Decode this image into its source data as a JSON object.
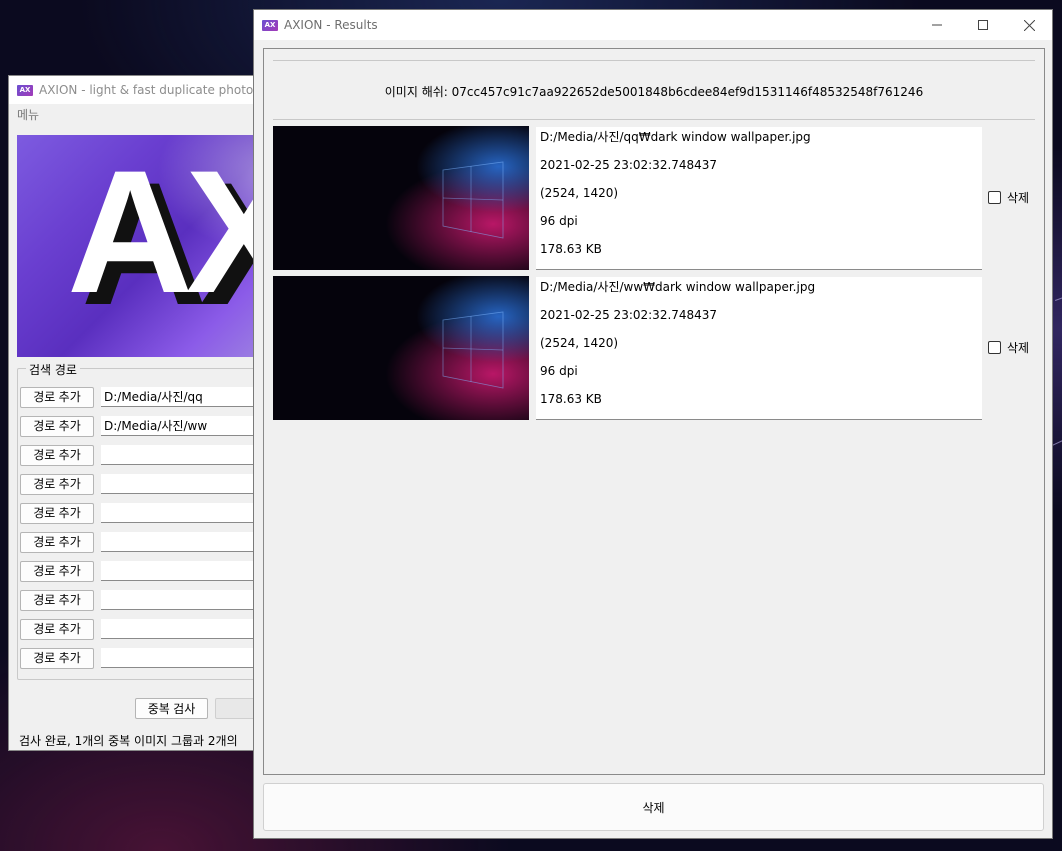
{
  "back_window": {
    "title": "AXION - light & fast duplicate photo fin",
    "menu_label": "메뉴",
    "banner_text": "AX",
    "group_label": "검색 경로",
    "add_path_label": "경로 추가",
    "paths": [
      "D:/Media/사진/qq",
      "D:/Media/사진/ww",
      "",
      "",
      "",
      "",
      "",
      "",
      "",
      ""
    ],
    "search_button": "중복 검사",
    "status": "검사 완료, 1개의 중복 이미지 그룹과 2개의"
  },
  "front_window": {
    "title": "AXION - Results",
    "hash": "이미지 해쉬: 07cc457c91c7aa922652de5001848b6cdee84ef9d1531146f48532548f761246",
    "results": [
      {
        "path": "D:/Media/사진/qq₩dark window wallpaper.jpg",
        "datetime": "2021-02-25 23:02:32.748437",
        "resolution": "(2524, 1420)",
        "dpi": "96 dpi",
        "size": "178.63 KB",
        "delete_label": "삭제"
      },
      {
        "path": "D:/Media/사진/ww₩dark window wallpaper.jpg",
        "datetime": "2021-02-25 23:02:32.748437",
        "resolution": "(2524, 1420)",
        "dpi": "96 dpi",
        "size": "178.63 KB",
        "delete_label": "삭제"
      }
    ],
    "delete_button": "삭제"
  },
  "colors": {
    "banner_purple": "#6a3fd0",
    "thumb_blue": "#2a6fd6",
    "thumb_pink": "#c2186b"
  }
}
